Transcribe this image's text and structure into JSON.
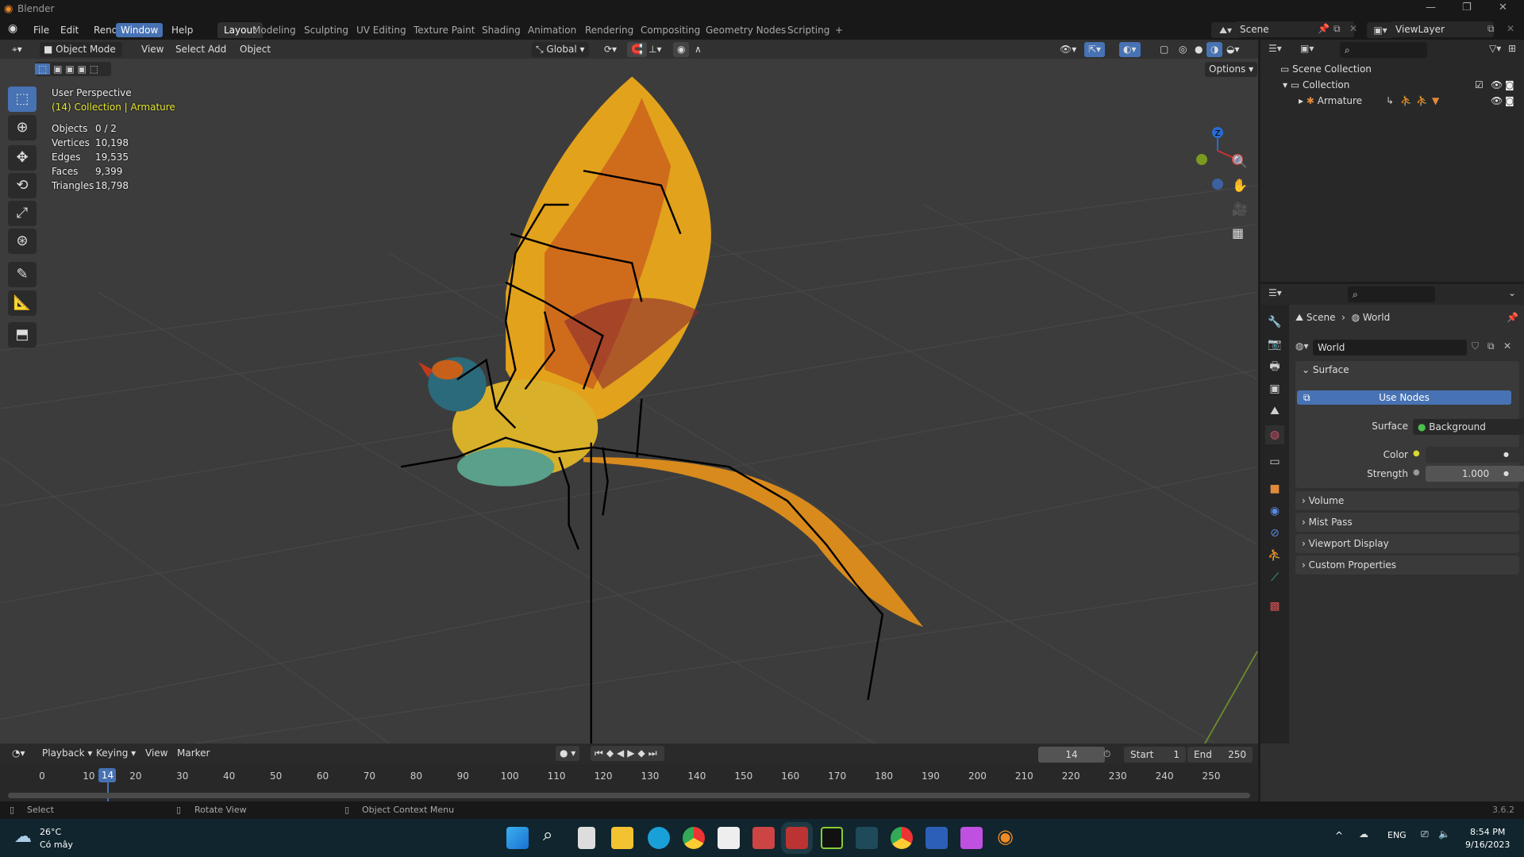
{
  "app": {
    "title": "Blender",
    "version": "3.6.2"
  },
  "menu": [
    "File",
    "Edit",
    "Render",
    "Window",
    "Help"
  ],
  "active_menu": "Window",
  "workspaces": [
    "Layout",
    "Modeling",
    "Sculpting",
    "UV Editing",
    "Texture Paint",
    "Shading",
    "Animation",
    "Rendering",
    "Compositing",
    "Geometry Nodes",
    "Scripting"
  ],
  "active_workspace": "Layout",
  "add_workspace": "+",
  "scene": {
    "name": "Scene",
    "view_layer": "ViewLayer"
  },
  "viewport_header": {
    "mode": "Object Mode",
    "view": "View",
    "select": "Select",
    "add": "Add",
    "object": "Object",
    "orientation": "Global",
    "options": "Options"
  },
  "overlay": {
    "perspective": "User Perspective",
    "collection": "(14) Collection | Armature",
    "stats": [
      {
        "label": "Objects",
        "value": "0 / 2"
      },
      {
        "label": "Vertices",
        "value": "10,198"
      },
      {
        "label": "Edges",
        "value": "19,535"
      },
      {
        "label": "Faces",
        "value": "9,399"
      },
      {
        "label": "Triangles",
        "value": "18,798"
      }
    ]
  },
  "gizmo": {
    "z": "Z",
    "x": "X"
  },
  "outliner": {
    "scene_collection": "Scene Collection",
    "collection": "Collection",
    "armature": "Armature"
  },
  "properties": {
    "breadcrumb_scene": "Scene",
    "breadcrumb_world": "World",
    "world_name": "World",
    "surface_panel": "Surface",
    "use_nodes": "Use Nodes",
    "surface_label": "Surface",
    "surface_value": "Background",
    "color_label": "Color",
    "strength_label": "Strength",
    "strength_value": "1.000",
    "panels": [
      "Volume",
      "Mist Pass",
      "Viewport Display",
      "Custom Properties"
    ]
  },
  "timeline": {
    "playback": "Playback",
    "keying": "Keying",
    "view": "View",
    "marker": "Marker",
    "current_frame": "14",
    "start_label": "Start",
    "start": "1",
    "end_label": "End",
    "end": "250",
    "ticks": [
      0,
      10,
      20,
      30,
      40,
      50,
      60,
      70,
      80,
      90,
      100,
      110,
      120,
      130,
      140,
      150,
      160,
      170,
      180,
      190,
      200,
      210,
      220,
      230,
      240,
      250
    ]
  },
  "statusbar": {
    "select": "Select",
    "rotate": "Rotate View",
    "context": "Object Context Menu"
  },
  "taskbar": {
    "temp": "26°C",
    "weather": "Có mây",
    "lang": "ENG",
    "time": "8:54 PM",
    "date": "9/16/2023"
  },
  "colors": {
    "accent": "#4772b3",
    "bg": "#3c3c3c",
    "collection_text": "#e6e62e"
  }
}
